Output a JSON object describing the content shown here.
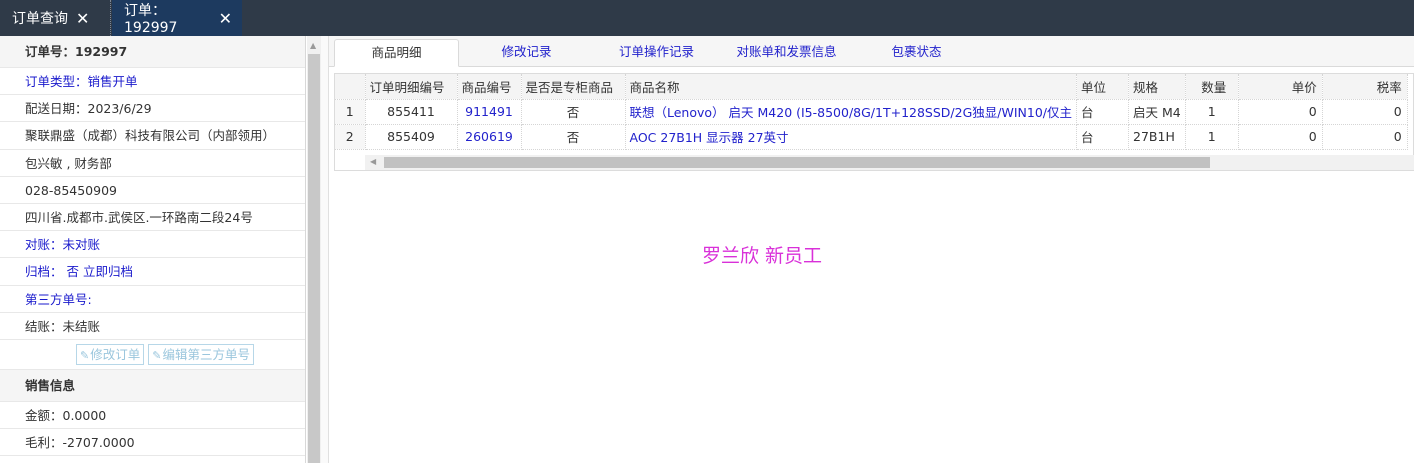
{
  "top_tabs": [
    {
      "label": "订单查询",
      "close": "✕"
    },
    {
      "label": "订单：192997",
      "close": "✕"
    }
  ],
  "left": {
    "order_no": "订单号：192997",
    "order_type": "订单类型：销售开单",
    "delivery_date": "配送日期：2023/6/29",
    "company": "聚联鼎盛（成都）科技有限公司（内部领用）",
    "contact": "包兴敏 , 财务部",
    "phone": "028-85450909",
    "address": "四川省.成都市.武侯区.一环路南二段24号",
    "reconcile": "对账：未对账",
    "archive": "归档： 否 立即归档",
    "third_party_no": "第三方单号:",
    "settlement": "结账：未结账",
    "btn_edit_order": "修改订单",
    "btn_edit_third": "编辑第三方单号",
    "sales_section": "销售信息",
    "amount": "金额：0.0000",
    "gross_profit": "毛利：-2707.0000"
  },
  "main_tabs": [
    "商品明细",
    "修改记录",
    "订单操作记录",
    "对账单和发票信息",
    "包裹状态"
  ],
  "table": {
    "headers": [
      "订单明细编号",
      "商品编号",
      "是否是专柜商品",
      "商品名称",
      "单位",
      "规格",
      "数量",
      "单价",
      "税率"
    ],
    "rows": [
      {
        "num": "1",
        "detail_id": "855411",
        "product_id": "911491",
        "counter": "否",
        "name": "联想（Lenovo） 启天 M420 (I5-8500/8G/1T+128SSD/2G独显/WIN10/仅主",
        "unit": "台",
        "spec": "启天 M4",
        "qty": "1",
        "price": "0",
        "tax": "0"
      },
      {
        "num": "2",
        "detail_id": "855409",
        "product_id": "260619",
        "counter": "否",
        "name": "AOC 27B1H 显示器 27英寸",
        "unit": "台",
        "spec": "27B1H",
        "qty": "1",
        "price": "0",
        "tax": "0"
      }
    ]
  },
  "watermark": "罗兰欣 新员工",
  "colors": {
    "topbar": "#2f3a48",
    "active_tab": "#1d3a5f",
    "link": "#2222cc",
    "watermark": "#d930d9"
  }
}
